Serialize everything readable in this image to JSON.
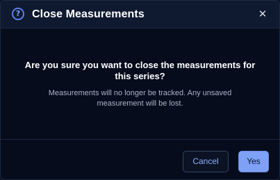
{
  "dialog": {
    "title": "Close Measurements",
    "help_icon_glyph": "?",
    "close_icon_glyph": "✕",
    "question": "Are you sure you want to close the measurements for this series?",
    "detail": "Measurements will no longer be tracked. Any unsaved measurement will be lost.",
    "cancel_label": "Cancel",
    "confirm_label": "Yes"
  },
  "icons": {
    "help": "question-circle-icon",
    "close": "close-icon"
  },
  "colors": {
    "accent": "#7ea1f5",
    "background": "#060c1c",
    "header": "#0f1a31"
  }
}
